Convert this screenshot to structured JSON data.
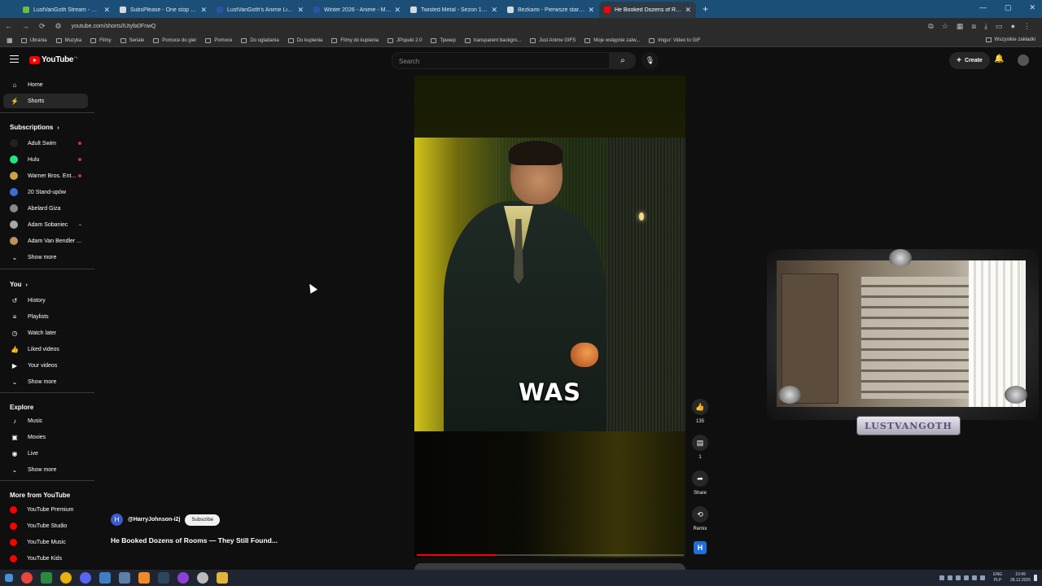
{
  "browser": {
    "tabs": [
      {
        "title": "LustVanGoth Stream - Watch Li",
        "color": "#6bbf3a"
      },
      {
        "title": "SubsPlease - One stop shop fo",
        "color": "#d9d9d9"
      },
      {
        "title": "LustVanGoth's Anime List - My",
        "color": "#2e51a2"
      },
      {
        "title": "Winter 2026 - Anime - MyAnim",
        "color": "#2e51a2"
      },
      {
        "title": "Twisted Metal - Sezon 1 Odcin",
        "color": "#d9d9d9"
      },
      {
        "title": "Bezkami - Pierwsze starcie / Th",
        "color": "#d9d9d9"
      },
      {
        "title": "He Booked Dozens of Room",
        "color": "#ff0000"
      }
    ],
    "url": "youtube.com/shorts/IUtyfa0FnwQ",
    "bookmarks": [
      "Ubrania",
      "Muzyka",
      "Filmy",
      "Seriale",
      "Pomoce do gier",
      "Pomoce",
      "Do ogladania",
      "Do kupienia",
      "Filmy do kupienia",
      "JPopuki 2.0",
      "Трекер",
      "transparent backgro...",
      "Just Anime GIFS",
      "Moje wstępnie zatw...",
      "Imgur: Video to GIF"
    ],
    "bookmarks_right": "Wszystkie zakładki"
  },
  "youtube": {
    "logo": "YouTube",
    "logo_country": "PL",
    "search_placeholder": "Search",
    "create_label": "Create",
    "nav": [
      {
        "label": "Home",
        "icon": "⌂"
      },
      {
        "label": "Shorts",
        "icon": "⚡"
      }
    ],
    "subscriptions_heading": "Subscriptions",
    "subscriptions": [
      {
        "label": "Adult Swim",
        "color": "#222",
        "badge": "live"
      },
      {
        "label": "Hulu",
        "color": "#1ce783",
        "badge": "live"
      },
      {
        "label": "Warner Bros. Ent...",
        "color": "#c9a24a",
        "badge": "live"
      },
      {
        "label": "20 Stand-upów",
        "color": "#3a6fd8",
        "badge": ""
      },
      {
        "label": "Abelard Giza",
        "color": "#888",
        "badge": ""
      },
      {
        "label": "Adam Sobaniec",
        "color": "#a7a7a7",
        "badge": "dot"
      },
      {
        "label": "Adam Van Bendler ...",
        "color": "#c28f5a",
        "badge": ""
      }
    ],
    "show_more": "Show more",
    "you_heading": "You",
    "you_items": [
      {
        "label": "History",
        "icon": "↺"
      },
      {
        "label": "Playlists",
        "icon": "≡"
      },
      {
        "label": "Watch later",
        "icon": "◷"
      },
      {
        "label": "Liked videos",
        "icon": "👍"
      },
      {
        "label": "Your videos",
        "icon": "▶"
      }
    ],
    "explore_heading": "Explore",
    "explore_items": [
      {
        "label": "Music",
        "icon": "♪"
      },
      {
        "label": "Movies",
        "icon": "▣"
      },
      {
        "label": "Live",
        "icon": "◉"
      }
    ],
    "more_heading": "More from YouTube",
    "more_items": [
      "YouTube Premium",
      "YouTube Studio",
      "YouTube Music",
      "YouTube Kids"
    ],
    "short": {
      "caption": "WAS",
      "channel_handle": "@HarryJohnson-i2j",
      "channel_initial": "H",
      "subscribe_label": "Subscribe",
      "title": "He Booked Dozens of Rooms — They Still Found...",
      "likes": "135",
      "comments": "1",
      "share_label": "Share",
      "remix_label": "Remix",
      "progress": 0.3
    }
  },
  "overlay": {
    "plaque_text": "LUSTVANGOTH"
  },
  "taskbar": {
    "lang": "ENG",
    "lang2": "PLP",
    "time": "10:49",
    "date": "28.12.2025"
  }
}
